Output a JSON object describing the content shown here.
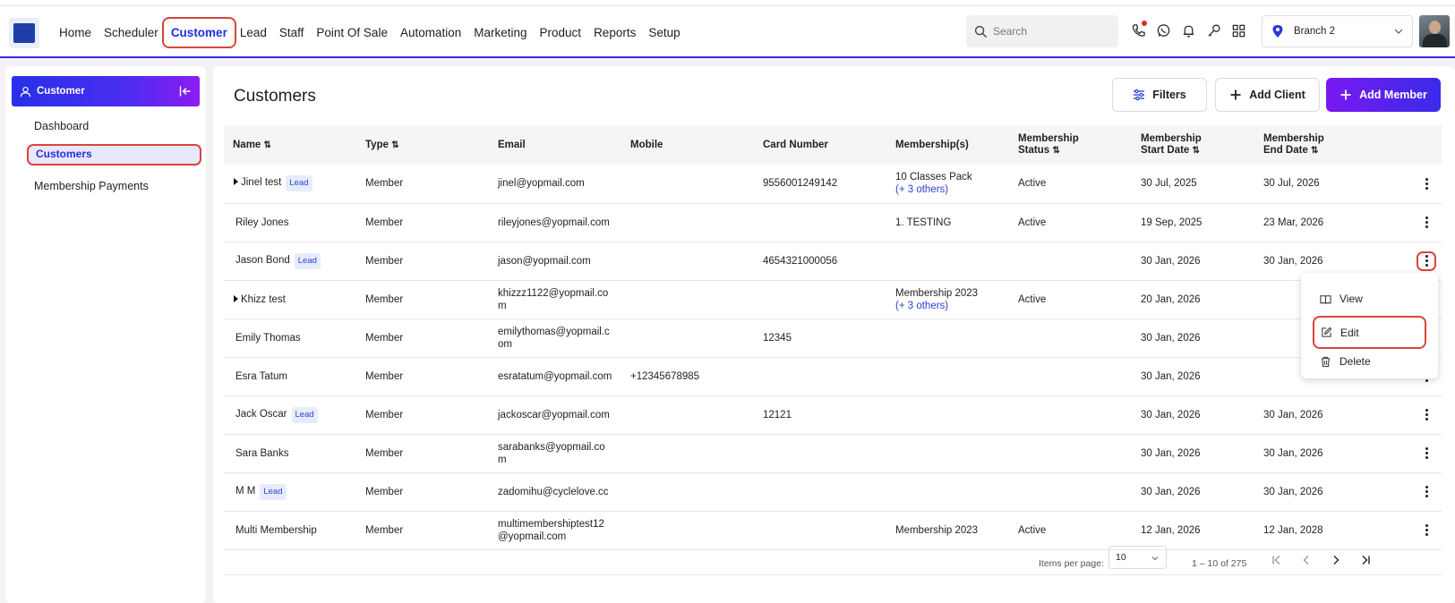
{
  "nav": {
    "items": [
      "Home",
      "Scheduler",
      "Customer",
      "Lead",
      "Staff",
      "Point Of Sale",
      "Automation",
      "Marketing",
      "Product",
      "Reports",
      "Setup"
    ],
    "active": "Customer"
  },
  "search": {
    "placeholder": "Search"
  },
  "top_icons": [
    "phone-icon",
    "whatsapp-icon",
    "bell-icon",
    "key-icon",
    "grid-icon"
  ],
  "branch": {
    "label": "Branch 2"
  },
  "sidebar": {
    "title": "Customer",
    "items": [
      "Dashboard",
      "Customers",
      "Membership Payments"
    ],
    "active": "Customers"
  },
  "main": {
    "title": "Customers",
    "buttons": {
      "filters": "Filters",
      "add_client": "Add Client",
      "add_member": "Add Member"
    }
  },
  "table": {
    "headers": {
      "name": "Name",
      "type": "Type",
      "email": "Email",
      "mobile": "Mobile",
      "card": "Card Number",
      "memberships": "Membership(s)",
      "status_1": "Membership",
      "status_2": "Status",
      "start_1": "Membership",
      "start_2": "Start Date",
      "end_1": "Membership",
      "end_2": "End Date"
    },
    "lead_label": "Lead",
    "rows": [
      {
        "name": "Jinel test",
        "lead": true,
        "expand": true,
        "type": "Member",
        "email": "jinel@yopmail.com",
        "mobile": "",
        "card": "9556001249142",
        "membership": "10 Classes Pack",
        "others": "(+ 3 others)",
        "status": "Active",
        "start": "30 Jul, 2025",
        "end": "30 Jul, 2026"
      },
      {
        "name": "Riley Jones",
        "lead": false,
        "expand": false,
        "type": "Member",
        "email": "rileyjones@yopmail.com",
        "mobile": "",
        "card": "",
        "membership": "1. TESTING",
        "others": "",
        "status": "Active",
        "start": "19 Sep, 2025",
        "end": "23 Mar, 2026"
      },
      {
        "name": "Jason Bond",
        "lead": true,
        "expand": false,
        "type": "Member",
        "email": "jason@yopmail.com",
        "mobile": "",
        "card": "4654321000056",
        "membership": "",
        "others": "",
        "status": "",
        "start": "30 Jan, 2026",
        "end": "30 Jan, 2026"
      },
      {
        "name": "Khizz test",
        "lead": false,
        "expand": true,
        "type": "Member",
        "email": "khizzz1122@yopmail.co m",
        "mobile": "",
        "card": "",
        "membership": "Membership 2023",
        "others": "(+ 3 others)",
        "status": "Active",
        "start": "20 Jan, 2026",
        "end": ""
      },
      {
        "name": "Emily Thomas",
        "lead": false,
        "expand": false,
        "type": "Member",
        "email": "emilythomas@yopmail.c om",
        "mobile": "",
        "card": "12345",
        "membership": "",
        "others": "",
        "status": "",
        "start": "30 Jan, 2026",
        "end": ""
      },
      {
        "name": "Esra Tatum",
        "lead": false,
        "expand": false,
        "type": "Member",
        "email": "esratatum@yopmail.com",
        "mobile": "+12345678985",
        "card": "",
        "membership": "",
        "others": "",
        "status": "",
        "start": "30 Jan, 2026",
        "end": ""
      },
      {
        "name": "Jack Oscar",
        "lead": true,
        "expand": false,
        "type": "Member",
        "email": "jackoscar@yopmail.com",
        "mobile": "",
        "card": "12121",
        "membership": "",
        "others": "",
        "status": "",
        "start": "30 Jan, 2026",
        "end": "30 Jan, 2026"
      },
      {
        "name": "Sara Banks",
        "lead": false,
        "expand": false,
        "type": "Member",
        "email": "sarabanks@yopmail.co m",
        "mobile": "",
        "card": "",
        "membership": "",
        "others": "",
        "status": "",
        "start": "30 Jan, 2026",
        "end": "30 Jan, 2026"
      },
      {
        "name": "M M",
        "lead": true,
        "expand": false,
        "type": "Member",
        "email": "zadomihu@cyclelove.cc",
        "mobile": "",
        "card": "",
        "membership": "",
        "others": "",
        "status": "",
        "start": "30 Jan, 2026",
        "end": "30 Jan, 2026"
      },
      {
        "name": "Multi Membership",
        "lead": false,
        "expand": false,
        "type": "Member",
        "email": "multimembershiptest12 @yopmail.com",
        "mobile": "",
        "card": "",
        "membership": "Membership 2023",
        "others": "",
        "status": "Active",
        "start": "12 Jan, 2026",
        "end": "12 Jan, 2028"
      }
    ]
  },
  "pagination": {
    "items_per_page_label": "Items per page:",
    "items_per_page": "10",
    "range": "1 – 10 of 275"
  },
  "context_menu": {
    "items": [
      "View",
      "Edit",
      "Delete"
    ],
    "highlighted": "Edit"
  },
  "colors": {
    "accent": "#1f2ee0",
    "highlight_border": "#d9453b",
    "gradient_start": "#2730e8",
    "gradient_end": "#8c1cf2"
  }
}
